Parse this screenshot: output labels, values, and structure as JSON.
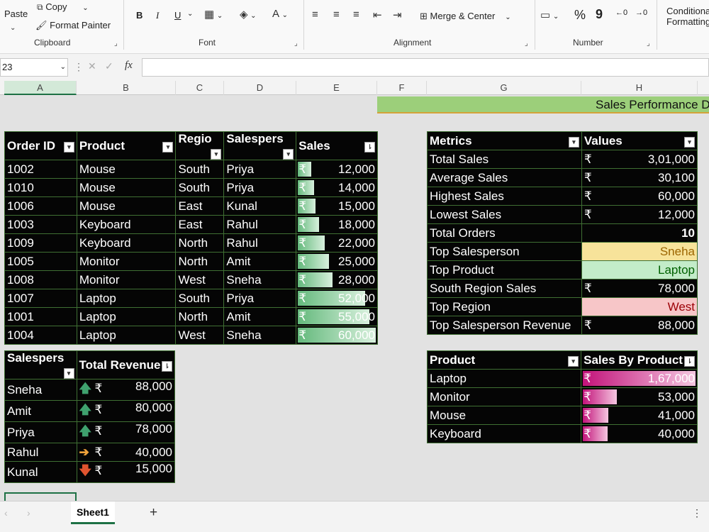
{
  "ribbon": {
    "paste": "Paste",
    "copy": "Copy",
    "format_painter": "Format Painter",
    "clipboard": "Clipboard",
    "font": "Font",
    "alignment": "Alignment",
    "merge_center": "Merge & Center",
    "number": "Number",
    "conditional": "Conditional",
    "formatting": "Formatting",
    "bold": "B",
    "italic": "I",
    "underline": "U",
    "percent": "%",
    "comma": "9"
  },
  "formula": {
    "name_box": "23",
    "fx": "fx"
  },
  "columns": [
    "A",
    "B",
    "C",
    "D",
    "E",
    "F",
    "G",
    "H"
  ],
  "banner": "Sales Performance D",
  "orders": {
    "headers": [
      "Order ID",
      "Product",
      "Regio",
      "Salespers",
      "Sales"
    ],
    "currency": "₹",
    "rows": [
      {
        "id": "1002",
        "product": "Mouse",
        "region": "South",
        "sp": "Priya",
        "sales": "12,000",
        "pct": 0.2
      },
      {
        "id": "1010",
        "product": "Mouse",
        "region": "South",
        "sp": "Priya",
        "sales": "14,000",
        "pct": 0.233
      },
      {
        "id": "1006",
        "product": "Mouse",
        "region": "East",
        "sp": "Kunal",
        "sales": "15,000",
        "pct": 0.25
      },
      {
        "id": "1003",
        "product": "Keyboard",
        "region": "East",
        "sp": "Rahul",
        "sales": "18,000",
        "pct": 0.3
      },
      {
        "id": "1009",
        "product": "Keyboard",
        "region": "North",
        "sp": "Rahul",
        "sales": "22,000",
        "pct": 0.367
      },
      {
        "id": "1005",
        "product": "Monitor",
        "region": "North",
        "sp": "Amit",
        "sales": "25,000",
        "pct": 0.417
      },
      {
        "id": "1008",
        "product": "Monitor",
        "region": "West",
        "sp": "Sneha",
        "sales": "28,000",
        "pct": 0.467
      },
      {
        "id": "1007",
        "product": "Laptop",
        "region": "South",
        "sp": "Priya",
        "sales": "52,000",
        "pct": 0.867
      },
      {
        "id": "1001",
        "product": "Laptop",
        "region": "North",
        "sp": "Amit",
        "sales": "55,000",
        "pct": 0.917
      },
      {
        "id": "1004",
        "product": "Laptop",
        "region": "West",
        "sp": "Sneha",
        "sales": "60,000",
        "pct": 1.0
      }
    ]
  },
  "revenue": {
    "headers": [
      "Salespers",
      "Total Revenue"
    ],
    "rows": [
      {
        "sp": "Sneha",
        "icon": "arrow-up-icon",
        "value": "88,000"
      },
      {
        "sp": "Amit",
        "icon": "arrow-up-icon",
        "value": "80,000"
      },
      {
        "sp": "Priya",
        "icon": "arrow-up-icon",
        "value": "78,000"
      },
      {
        "sp": "Rahul",
        "icon": "arrow-right-icon",
        "value": "40,000"
      },
      {
        "sp": "Kunal",
        "icon": "arrow-down-icon",
        "value": "15,000"
      }
    ]
  },
  "metrics": {
    "headers": [
      "Metrics",
      "Values"
    ],
    "rows": [
      {
        "label": "Total Sales",
        "cur": "₹",
        "value": "3,01,000",
        "fill": ""
      },
      {
        "label": "Average Sales",
        "cur": "₹",
        "value": "30,100",
        "fill": ""
      },
      {
        "label": "Highest Sales",
        "cur": "₹",
        "value": "60,000",
        "fill": ""
      },
      {
        "label": "Lowest Sales",
        "cur": "₹",
        "value": "12,000",
        "fill": ""
      },
      {
        "label": "Total Orders",
        "cur": "",
        "value": "10",
        "fill": "bold"
      },
      {
        "label": "Top Salesperson",
        "cur": "",
        "value": "Sneha",
        "fill": "yellow"
      },
      {
        "label": "Top Product",
        "cur": "",
        "value": "Laptop",
        "fill": "green"
      },
      {
        "label": "South Region Sales",
        "cur": "₹",
        "value": "78,000",
        "fill": ""
      },
      {
        "label": "Top Region",
        "cur": "",
        "value": "West",
        "fill": "red"
      },
      {
        "label": "Top Salesperson Revenue",
        "cur": "₹",
        "value": "88,000",
        "fill": ""
      }
    ]
  },
  "byproduct": {
    "headers": [
      "Product",
      "Sales By Product"
    ],
    "rows": [
      {
        "product": "Laptop",
        "value": "1,67,000",
        "pct": 1.0
      },
      {
        "product": "Monitor",
        "value": "53,000",
        "pct": 0.317
      },
      {
        "product": "Mouse",
        "value": "41,000",
        "pct": 0.246
      },
      {
        "product": "Keyboard",
        "value": "40,000",
        "pct": 0.24
      }
    ]
  },
  "sheet_tab": "Sheet1",
  "add_sheet": "+",
  "colors": {
    "accent": "#1e7145",
    "table_bg": "#050505",
    "border": "#3f6f33",
    "bar_green": "#64b97c",
    "bar_pink": "#c2137a",
    "banner": "#9ccf7a",
    "fill_yellow": "#f7e39a",
    "fill_green": "#c3ecc9",
    "fill_red": "#f7c6c8"
  }
}
